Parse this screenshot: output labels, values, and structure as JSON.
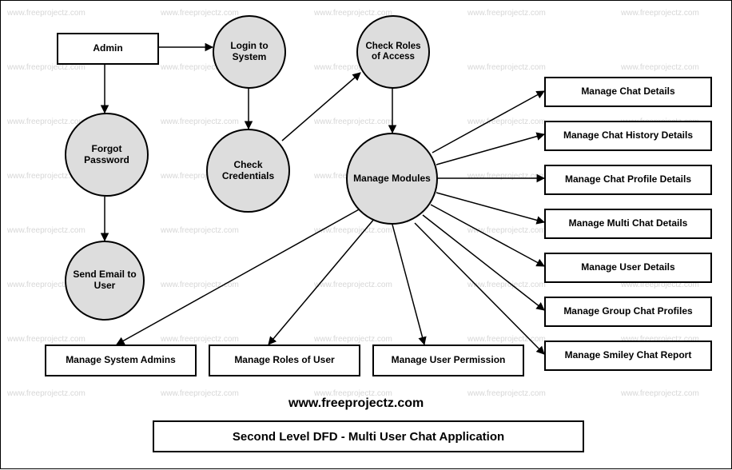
{
  "watermark_text": "www.freeprojectz.com",
  "site_label": "www.freeprojectz.com",
  "title": "Second Level DFD - Multi User Chat Application",
  "nodes": {
    "admin": "Admin",
    "login": "Login to System",
    "check_roles": "Check Roles of Access",
    "forgot_pw": "Forgot Password",
    "check_creds": "Check Credentials",
    "manage_modules": "Manage Modules",
    "send_email": "Send Email to User",
    "m_chat_details": "Manage Chat Details",
    "m_chat_history": "Manage Chat History Details",
    "m_chat_profile": "Manage Chat Profile Details",
    "m_multi_chat": "Manage Multi Chat Details",
    "m_user_details": "Manage User Details",
    "m_group_chat": "Manage Group Chat Profiles",
    "m_smiley_report": "Manage Smiley Chat  Report",
    "m_sys_admins": "Manage System Admins",
    "m_roles_user": "Manage Roles of User",
    "m_user_perm": "Manage User Permission"
  },
  "chart_data": {
    "type": "diagram",
    "diagram_type": "data_flow_diagram",
    "level": "Second Level DFD",
    "subject": "Multi User Chat Application",
    "external_entities": [
      "Admin"
    ],
    "processes": [
      "Login to System",
      "Check Roles of Access",
      "Forgot Password",
      "Check Credentials",
      "Manage Modules",
      "Send Email to User"
    ],
    "data_stores_or_modules": [
      "Manage Chat Details",
      "Manage Chat History Details",
      "Manage Chat Profile Details",
      "Manage Multi Chat Details",
      "Manage User Details",
      "Manage Group Chat Profiles",
      "Manage Smiley Chat  Report",
      "Manage System Admins",
      "Manage Roles of User",
      "Manage User Permission"
    ],
    "flows": [
      [
        "Admin",
        "Login to System"
      ],
      [
        "Admin",
        "Forgot Password"
      ],
      [
        "Login to System",
        "Check Credentials"
      ],
      [
        "Check Credentials",
        "Check Roles of Access"
      ],
      [
        "Check Roles of Access",
        "Manage Modules"
      ],
      [
        "Forgot Password",
        "Send Email to User"
      ],
      [
        "Manage Modules",
        "Manage Chat Details"
      ],
      [
        "Manage Modules",
        "Manage Chat History Details"
      ],
      [
        "Manage Modules",
        "Manage Chat Profile Details"
      ],
      [
        "Manage Modules",
        "Manage Multi Chat Details"
      ],
      [
        "Manage Modules",
        "Manage User Details"
      ],
      [
        "Manage Modules",
        "Manage Group Chat Profiles"
      ],
      [
        "Manage Modules",
        "Manage Smiley Chat  Report"
      ],
      [
        "Manage Modules",
        "Manage System Admins"
      ],
      [
        "Manage Modules",
        "Manage Roles of User"
      ],
      [
        "Manage Modules",
        "Manage User Permission"
      ]
    ]
  }
}
